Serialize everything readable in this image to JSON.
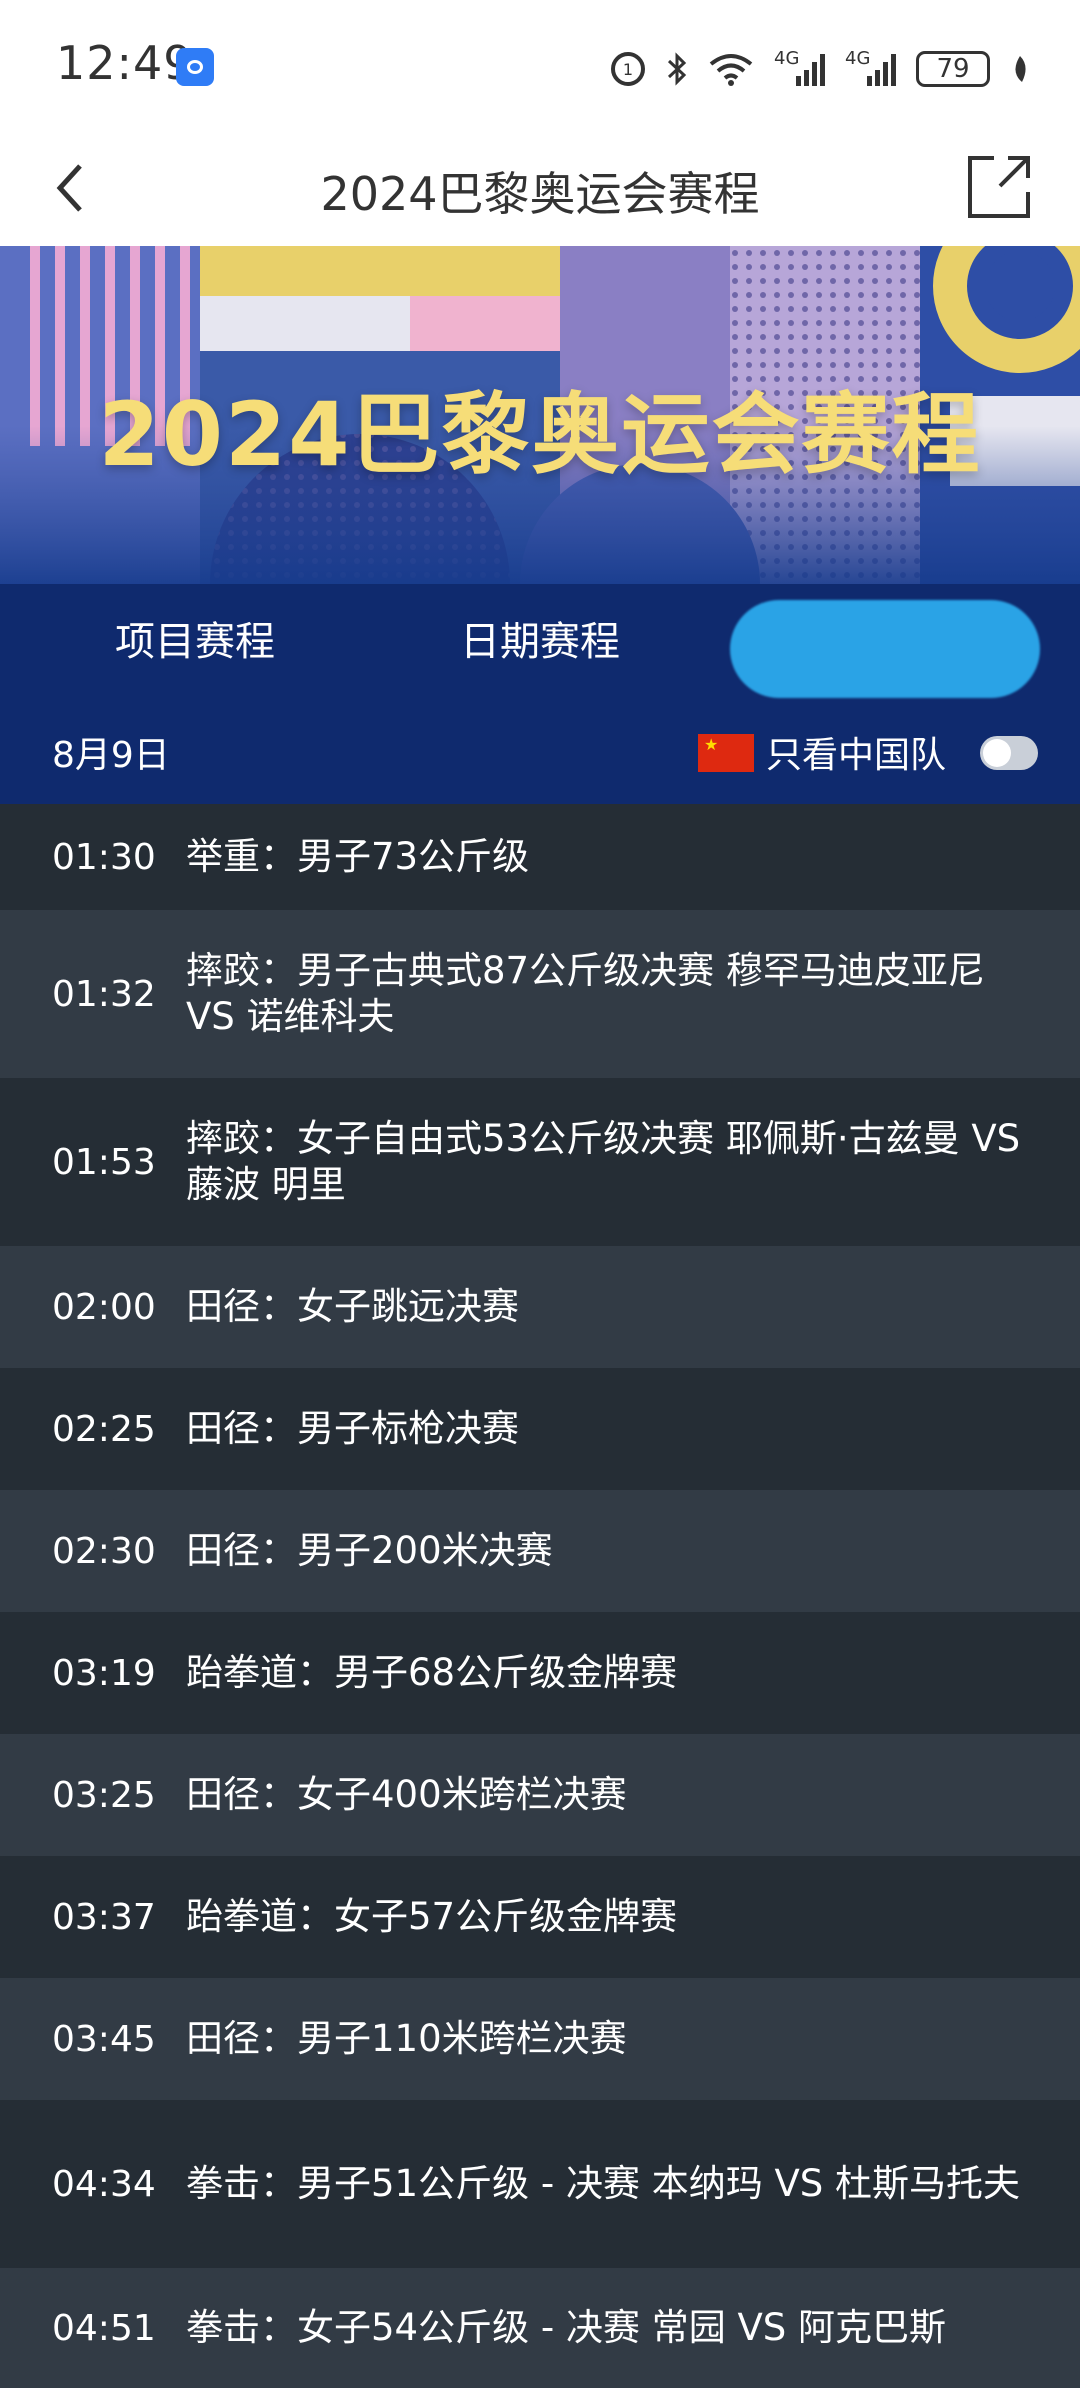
{
  "status_bar": {
    "time": "12:49",
    "battery": "79",
    "network_1": "4G",
    "network_2": "4G",
    "icons": [
      "app-lock-icon",
      "hd-call-icon",
      "bluetooth-icon",
      "wifi-icon",
      "signal-icon",
      "signal-icon",
      "battery-icon",
      "leaf-icon"
    ]
  },
  "header": {
    "title": "2024巴黎奥运会赛程",
    "back_icon": "chevron-left-icon",
    "share_icon": "share-external-icon"
  },
  "banner": {
    "title": "2024巴黎奥运会赛程"
  },
  "tabs": [
    {
      "label": "项目赛程"
    },
    {
      "label": "日期赛程"
    }
  ],
  "filter": {
    "date": "8月9日",
    "label": "只看中国队",
    "flag": "china-flag-icon",
    "toggle_on": false
  },
  "events": [
    {
      "time": "01:30",
      "desc": "举重：男子73公斤级"
    },
    {
      "time": "01:32",
      "desc": "摔跤：男子古典式87公斤级决赛 穆罕马迪皮亚尼 VS 诺维科夫"
    },
    {
      "time": "01:53",
      "desc": "摔跤：女子自由式53公斤级决赛 耶佩斯·古兹曼 VS 藤波 明里"
    },
    {
      "time": "02:00",
      "desc": "田径：女子跳远决赛"
    },
    {
      "time": "02:25",
      "desc": "田径：男子标枪决赛"
    },
    {
      "time": "02:30",
      "desc": "田径：男子200米决赛"
    },
    {
      "time": "03:19",
      "desc": "跆拳道：男子68公斤级金牌赛"
    },
    {
      "time": "03:25",
      "desc": "田径：女子400米跨栏决赛"
    },
    {
      "time": "03:37",
      "desc": "跆拳道：女子57公斤级金牌赛"
    },
    {
      "time": "03:45",
      "desc": "田径：男子110米跨栏决赛"
    },
    {
      "time": "04:34",
      "desc": "拳击：男子51公斤级 - 决赛 本纳玛 VS 杜斯马托夫"
    },
    {
      "time": "04:51",
      "desc": "拳击：女子54公斤级 - 决赛 常园 VS 阿克巴斯"
    }
  ],
  "colors": {
    "nav": "#0f2a6e",
    "row_dark": "#252d35",
    "row_light": "#323b45",
    "banner_title": "#f6dd78",
    "active_tab": "#2aa3e6"
  }
}
